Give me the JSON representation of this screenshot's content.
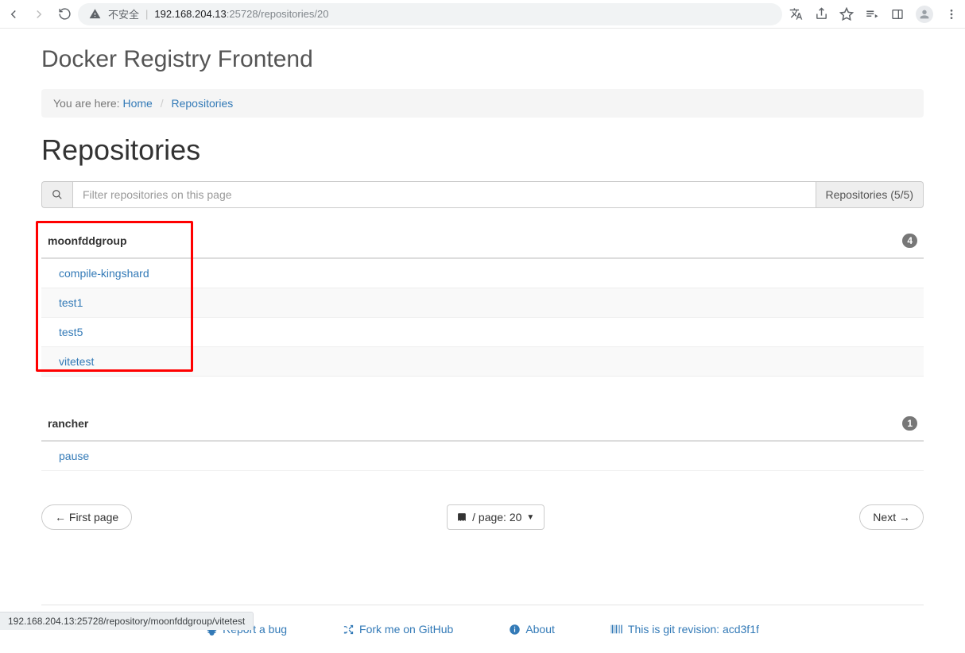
{
  "chrome": {
    "not_secure": "不安全",
    "url_host": "192.168.204.13",
    "url_port": ":25728",
    "url_path": "/repositories/20"
  },
  "header": {
    "title": "Docker Registry Frontend"
  },
  "breadcrumb": {
    "prefix": "You are here: ",
    "home": "Home",
    "current": "Repositories"
  },
  "page": {
    "heading": "Repositories"
  },
  "filter": {
    "placeholder": "Filter repositories on this page",
    "count_label": "Repositories (5/5)"
  },
  "groups": [
    {
      "name": "moonfddgroup",
      "count": "4",
      "items": [
        "compile-kingshard",
        "test1",
        "test5",
        "vitetest"
      ],
      "highlighted": true
    },
    {
      "name": "rancher",
      "count": "1",
      "items": [
        "pause"
      ],
      "highlighted": false
    }
  ],
  "pagination": {
    "first": "← First page",
    "per_page_label": "/ page: 20",
    "next": "Next →"
  },
  "footer": {
    "bug": "Report a bug",
    "fork": "Fork me on GitHub",
    "about": "About",
    "git_rev_label": "This is git revision: ",
    "git_rev": "acd3f1f"
  },
  "status_bar": "192.168.204.13:25728/repository/moonfddgroup/vitetest"
}
